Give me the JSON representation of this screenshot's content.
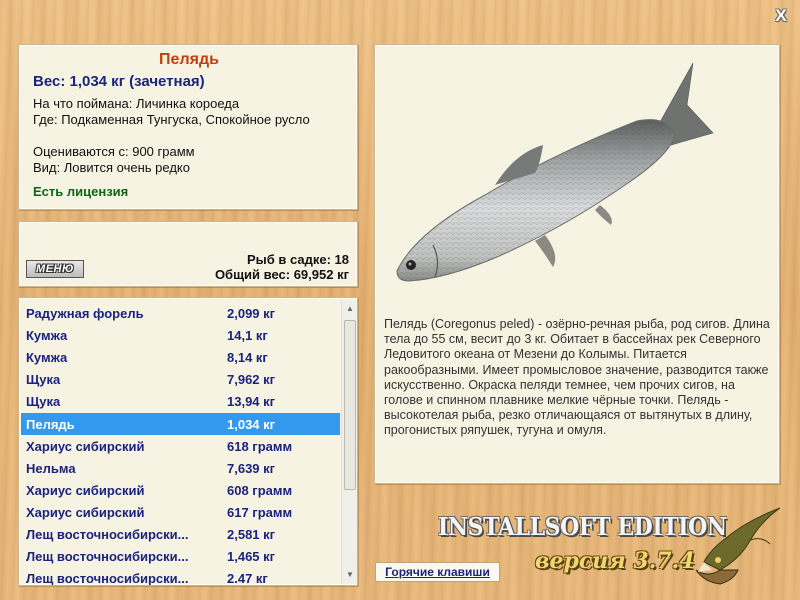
{
  "close_label": "X",
  "fish": {
    "name": "Пелядь",
    "weight": "Вес: 1,034 кг (зачетная)",
    "bait": "На что поймана: Личинка короеда",
    "location": "Где: Подкаменная Тунгуска, Спокойное русло",
    "valued_from": "Оцениваются с: 900 грамм",
    "kind": "Вид: Ловится очень редко",
    "license": "Есть лицензия"
  },
  "stats": {
    "menu_label": "МЕНЮ",
    "count": "Рыб в садке: 18",
    "total_weight": "Общий вес: 69,952 кг"
  },
  "catch_list": [
    {
      "name": "Радужная форель",
      "weight": "2,099 кг",
      "selected": false
    },
    {
      "name": "Кумжа",
      "weight": "14,1 кг",
      "selected": false
    },
    {
      "name": "Кумжа",
      "weight": "8,14 кг",
      "selected": false
    },
    {
      "name": "Щука",
      "weight": "7,962 кг",
      "selected": false
    },
    {
      "name": "Щука",
      "weight": "13,94 кг",
      "selected": false
    },
    {
      "name": "Пелядь",
      "weight": "1,034 кг",
      "selected": true
    },
    {
      "name": "Хариус сибирский",
      "weight": "618 грамм",
      "selected": false
    },
    {
      "name": "Нельма",
      "weight": "7,639 кг",
      "selected": false
    },
    {
      "name": "Хариус сибирский",
      "weight": "608 грамм",
      "selected": false
    },
    {
      "name": "Хариус сибирский",
      "weight": "617 грамм",
      "selected": false
    },
    {
      "name": "Лещ восточносибирски...",
      "weight": "2,581 кг",
      "selected": false
    },
    {
      "name": "Лещ восточносибирски...",
      "weight": "1,465 кг",
      "selected": false
    },
    {
      "name": "Лещ восточносибирски...",
      "weight": "2.47 кг",
      "selected": false
    }
  ],
  "description": "Пелядь (Coregonus peled) - озёрно-речная рыба, род сигов. Длина тела до 55 см, весит до 3 кг. Обитает в бассейнах рек Северного Ледовитого океана от Мезени до Колымы. Питается ракообразными. Имеет промысловое значение, разводится также искусственно. Окраска пеляди темнее, чем прочих сигов, на голове и спинном плавнике мелкие чёрные точки. Пелядь - высокотелая рыба, резко отличающаяся от вытянутых в длину, прогонистых ряпушек, тугуна и омуля.",
  "hotkeys_label": "Горячие клавиши",
  "edition": "INSTALLSOFT EDITION",
  "version": "версия 3.7.4",
  "icons": [
    "close-icon",
    "fish-image",
    "pike-logo-icon",
    "scroll-up-icon",
    "scroll-down-icon"
  ],
  "colors": {
    "accent_title": "#c0420a",
    "accent_text": "#1a237e",
    "license": "#106318",
    "selection": "#3399ee"
  }
}
